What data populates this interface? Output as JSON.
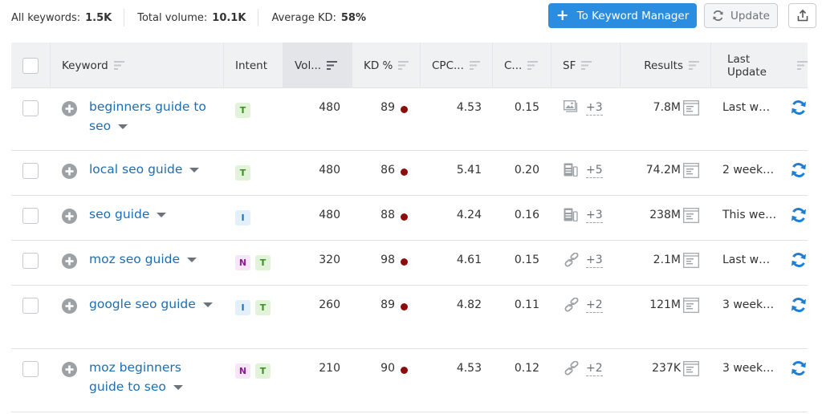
{
  "summary": {
    "all_keywords_label": "All keywords:",
    "all_keywords_value": "1.5K",
    "total_volume_label": "Total volume:",
    "total_volume_value": "10.1K",
    "average_kd_label": "Average KD:",
    "average_kd_value": "58%"
  },
  "toolbar": {
    "keyword_manager_label": "To Keyword Manager",
    "update_label": "Update",
    "plus_icon": "plus-icon",
    "update_icon": "refresh-icon",
    "export_icon": "export-icon"
  },
  "colors": {
    "primary": "#2b8de0",
    "link": "#1d6db3",
    "kd_very_hard": "#8b0d0d",
    "intent_T": "#3a8f1d",
    "intent_I": "#1d6db3",
    "intent_N": "#8a1d8f"
  },
  "table": {
    "columns": [
      {
        "key": "select",
        "label": ""
      },
      {
        "key": "keyword",
        "label": "Keyword"
      },
      {
        "key": "intent",
        "label": "Intent"
      },
      {
        "key": "volume",
        "label": "Vol...",
        "sorted": true
      },
      {
        "key": "kd",
        "label": "KD %"
      },
      {
        "key": "cpc",
        "label": "CPC..."
      },
      {
        "key": "com",
        "label": "C..."
      },
      {
        "key": "sf",
        "label": "SF"
      },
      {
        "key": "results",
        "label": "Results"
      },
      {
        "key": "last_update",
        "label": "Last Update"
      }
    ],
    "rows": [
      {
        "keyword": "beginners guide to seo",
        "intent": [
          "T"
        ],
        "volume": "480",
        "kd": "89",
        "cpc": "4.53",
        "com": "0.15",
        "sf_icon": "image-icon",
        "sf_more": "+3",
        "results": "7.8M",
        "last_update": "Last w…"
      },
      {
        "keyword": "local seo guide",
        "intent": [
          "T"
        ],
        "volume": "480",
        "kd": "86",
        "cpc": "5.41",
        "com": "0.20",
        "sf_icon": "news-icon",
        "sf_more": "+5",
        "results": "74.2M",
        "last_update": "2 week…"
      },
      {
        "keyword": "seo guide",
        "intent": [
          "I"
        ],
        "volume": "480",
        "kd": "88",
        "cpc": "4.24",
        "com": "0.16",
        "sf_icon": "news-icon",
        "sf_more": "+3",
        "results": "238M",
        "last_update": "This we…"
      },
      {
        "keyword": "moz seo guide",
        "intent": [
          "N",
          "T"
        ],
        "volume": "320",
        "kd": "98",
        "cpc": "4.61",
        "com": "0.15",
        "sf_icon": "link-icon",
        "sf_more": "+3",
        "results": "2.1M",
        "last_update": "Last w…"
      },
      {
        "keyword": "google seo guide",
        "intent": [
          "I",
          "T"
        ],
        "volume": "260",
        "kd": "89",
        "cpc": "4.82",
        "com": "0.11",
        "sf_icon": "link-icon",
        "sf_more": "+2",
        "results": "121M",
        "last_update": "3 week…"
      },
      {
        "keyword": "moz beginners guide to seo",
        "intent": [
          "N",
          "T"
        ],
        "volume": "210",
        "kd": "90",
        "cpc": "4.53",
        "com": "0.12",
        "sf_icon": "link-icon",
        "sf_more": "+2",
        "results": "237K",
        "last_update": "3 week…"
      }
    ]
  }
}
